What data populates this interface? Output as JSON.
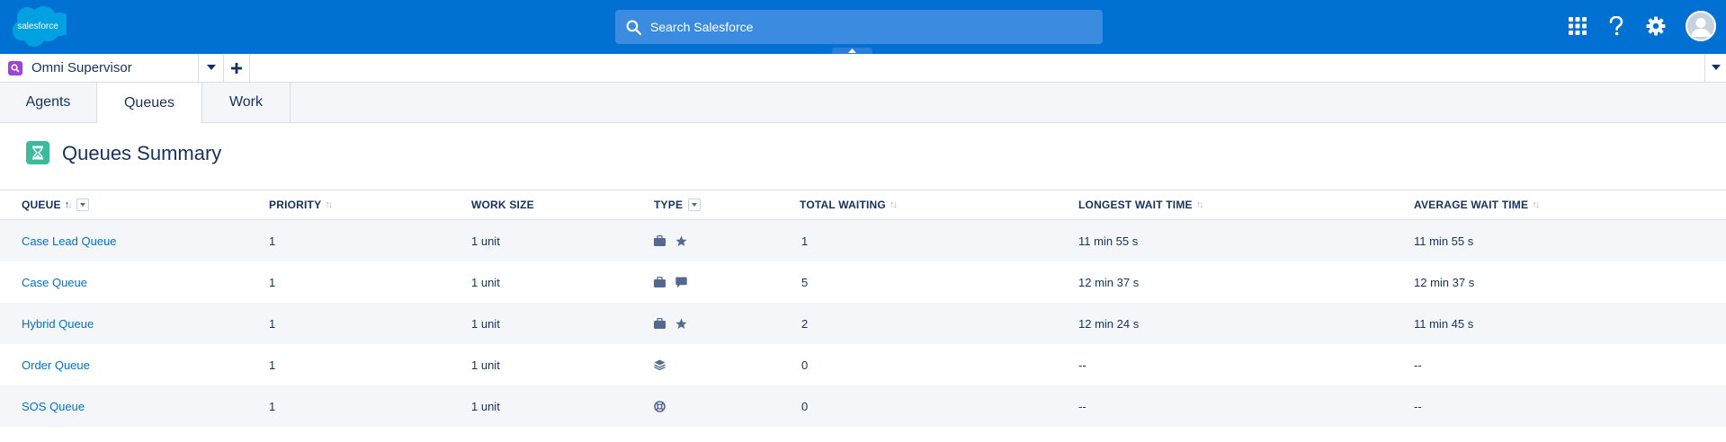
{
  "header": {
    "logo_text": "salesforce",
    "search_placeholder": "Search Salesforce"
  },
  "nav": {
    "app_name": "Omni Supervisor"
  },
  "subtabs": [
    {
      "label": "Agents",
      "active": false
    },
    {
      "label": "Queues",
      "active": true
    },
    {
      "label": "Work",
      "active": false
    }
  ],
  "page": {
    "title": "Queues Summary"
  },
  "table": {
    "columns": {
      "queue": "QUEUE",
      "priority": "PRIORITY",
      "work_size": "WORK SIZE",
      "type": "TYPE",
      "total_waiting": "TOTAL WAITING",
      "longest_wait": "LONGEST WAIT TIME",
      "average_wait": "AVERAGE WAIT TIME"
    },
    "rows": [
      {
        "queue": "Case Lead Queue",
        "priority": "1",
        "work_size": "1 unit",
        "types": [
          "briefcase-icon",
          "star-icon"
        ],
        "total_waiting": "1",
        "longest_wait": "11 min 55 s",
        "average_wait": "11 min 55 s"
      },
      {
        "queue": "Case Queue",
        "priority": "1",
        "work_size": "1 unit",
        "types": [
          "briefcase-icon",
          "chat-icon"
        ],
        "total_waiting": "5",
        "longest_wait": "12 min 37 s",
        "average_wait": "12 min 37 s"
      },
      {
        "queue": "Hybrid Queue",
        "priority": "1",
        "work_size": "1 unit",
        "types": [
          "briefcase-icon",
          "star-icon"
        ],
        "total_waiting": "2",
        "longest_wait": "12 min 24 s",
        "average_wait": "11 min 45 s"
      },
      {
        "queue": "Order Queue",
        "priority": "1",
        "work_size": "1 unit",
        "types": [
          "stack-icon"
        ],
        "total_waiting": "0",
        "longest_wait": "--",
        "average_wait": "--"
      },
      {
        "queue": "SOS Queue",
        "priority": "1",
        "work_size": "1 unit",
        "types": [
          "lifebuoy-icon"
        ],
        "total_waiting": "0",
        "longest_wait": "--",
        "average_wait": "--"
      }
    ]
  },
  "colors": {
    "header_blue": "#0070d2",
    "link_blue": "#0070d2",
    "text_navy": "#16325c",
    "app_icon_purple": "#9f43d8",
    "title_icon_teal": "#3bba9c",
    "type_icon_gray": "#54698d"
  }
}
